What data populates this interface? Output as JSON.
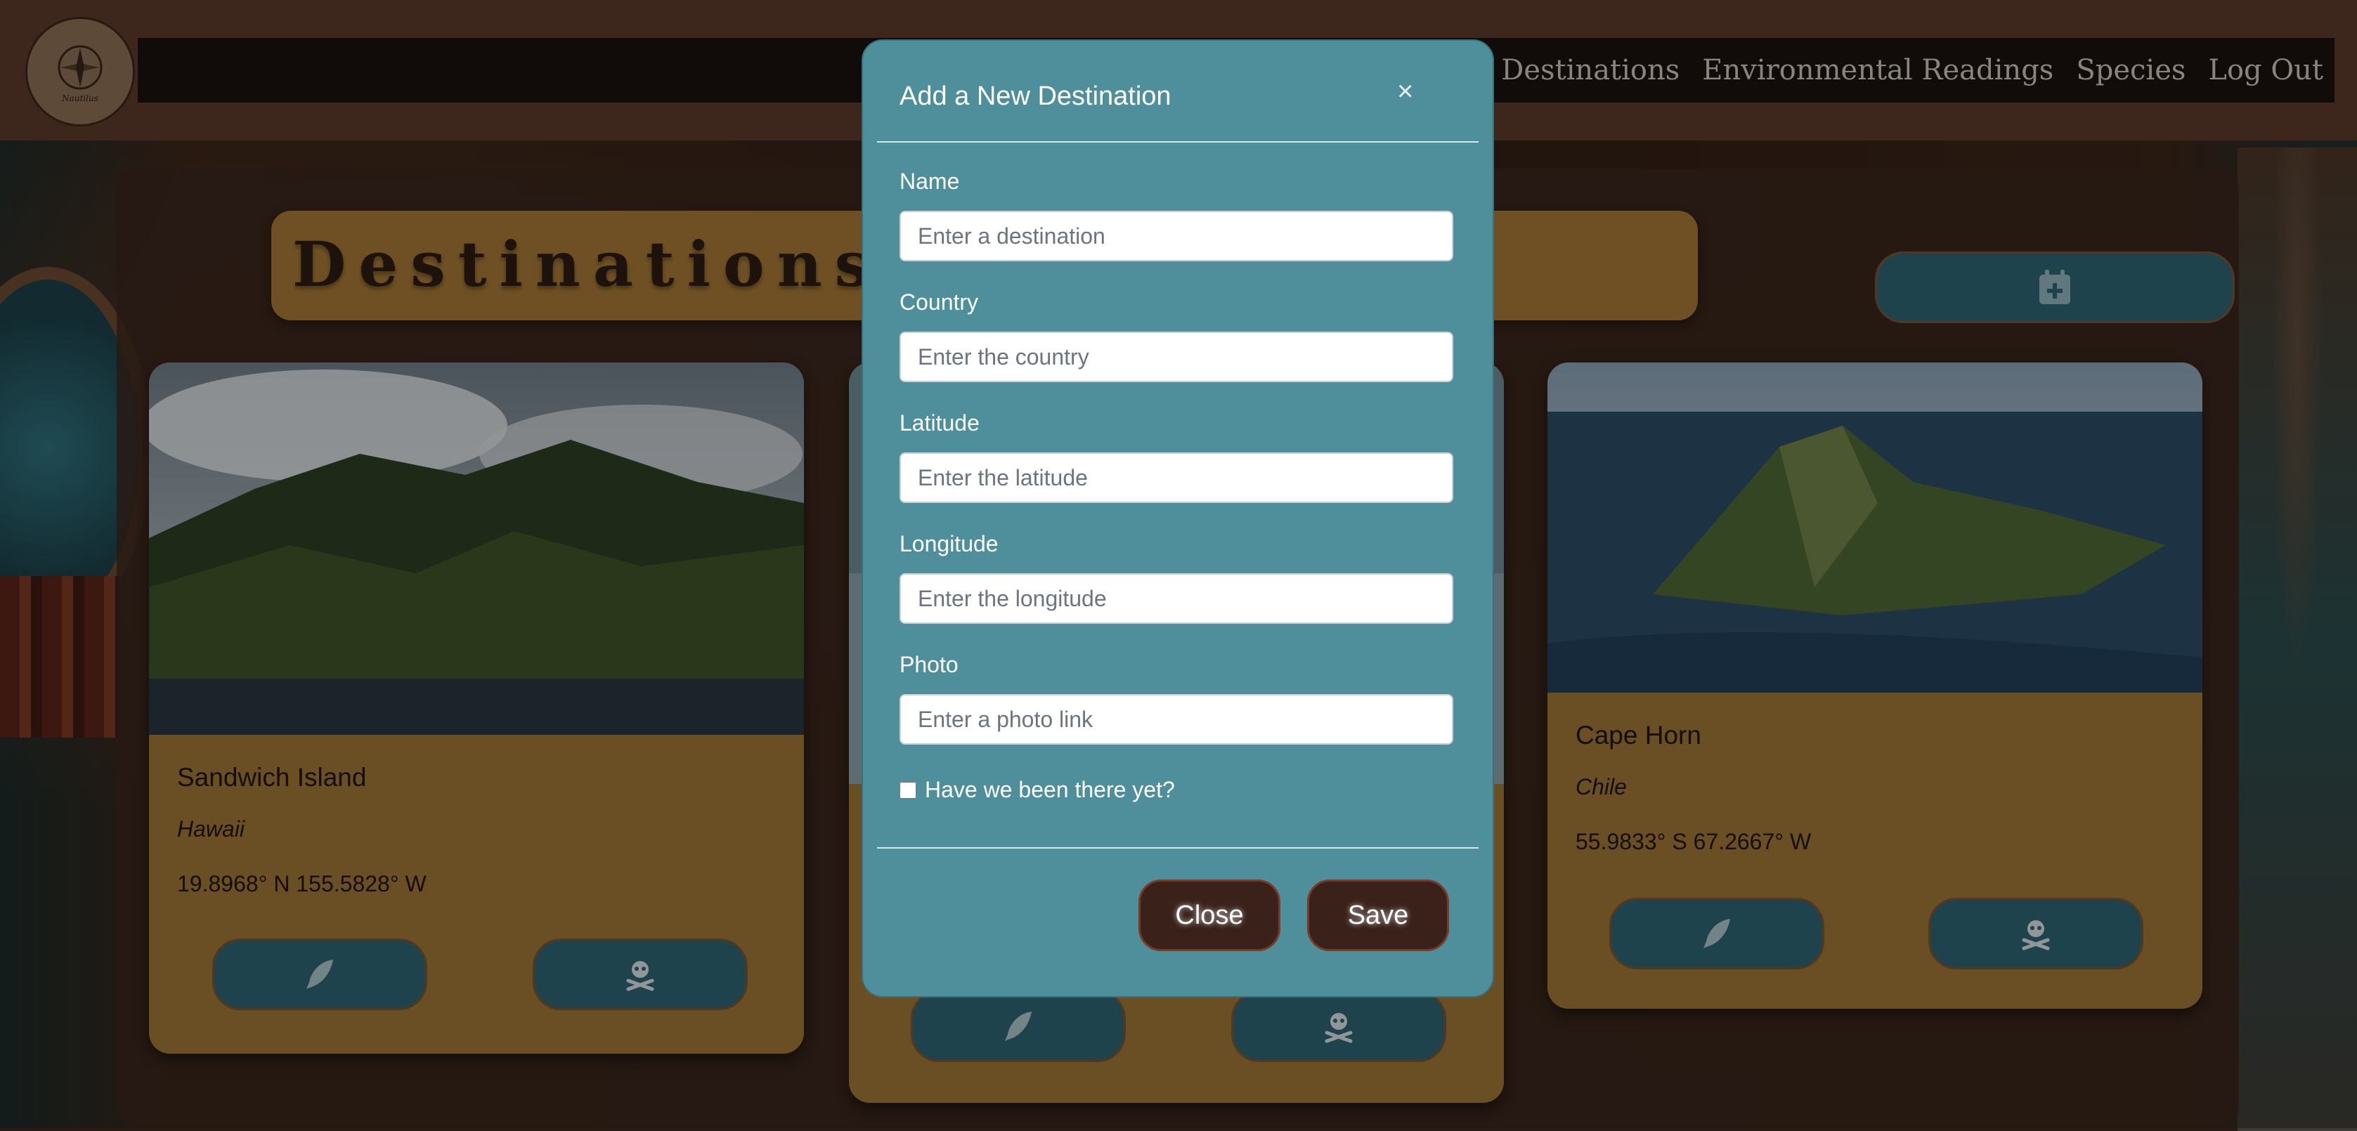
{
  "nav": {
    "logo_text": "Nautilus",
    "links": [
      "Destinations",
      "Environmental Readings",
      "Species",
      "Log Out"
    ]
  },
  "page": {
    "title": "Destinations"
  },
  "cards": [
    {
      "name": "Sandwich Island",
      "country": "Hawaii",
      "coords": "19.8968° N 155.5828° W"
    },
    {
      "name": "",
      "country": "",
      "coords": ""
    },
    {
      "name": "Cape Horn",
      "country": "Chile",
      "coords": "55.9833° S 67.2667° W"
    }
  ],
  "icons": {
    "edit": "feather-icon",
    "delete": "skull-crossbones-icon",
    "add": "calendar-plus-icon",
    "logo": "compass-icon"
  },
  "modal": {
    "title": "Add a New Destination",
    "close_x": "×",
    "fields": {
      "name": {
        "label": "Name",
        "placeholder": "Enter a destination"
      },
      "country": {
        "label": "Country",
        "placeholder": "Enter the country"
      },
      "latitude": {
        "label": "Latitude",
        "placeholder": "Enter the latitude"
      },
      "longitude": {
        "label": "Longitude",
        "placeholder": "Enter the longitude"
      },
      "photo": {
        "label": "Photo",
        "placeholder": "Enter a photo link"
      }
    },
    "visited_label": "Have we been there yet?",
    "visited_checked": false,
    "close_button": "Close",
    "save_button": "Save"
  },
  "colors": {
    "modal_bg": "#4f8f9c",
    "button_teal": "#2f6470",
    "card_bg": "#9c7335",
    "navbar": "#1a1210",
    "dark_button": "#3a211a"
  }
}
